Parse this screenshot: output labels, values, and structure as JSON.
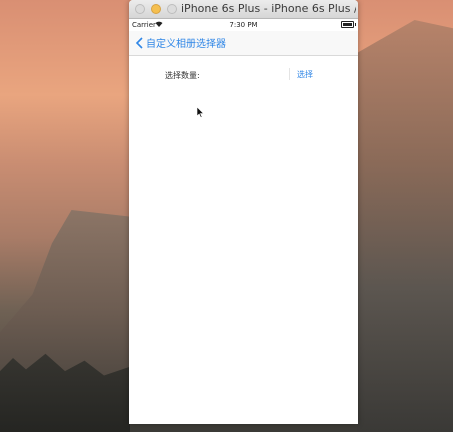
{
  "simulator": {
    "window_title": "iPhone 6s Plus - iPhone 6s Plus / i..."
  },
  "statusbar": {
    "carrier": "Carrier",
    "wifi_icon": "wifi-icon",
    "time": "7:30 PM",
    "battery_icon": "battery-icon"
  },
  "navbar": {
    "back_label": "自定义相册选择器"
  },
  "content": {
    "count_label": "选择数量:",
    "count_input_value": "",
    "select_button": "选择"
  },
  "colors": {
    "accent": "#2f86e6",
    "traffic_min": "#f5bf4f"
  }
}
